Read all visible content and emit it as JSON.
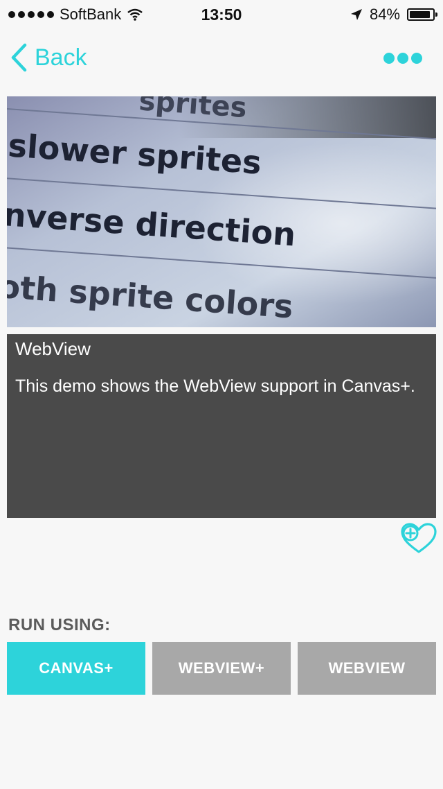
{
  "status_bar": {
    "carrier": "SoftBank",
    "time": "13:50",
    "battery": "84%",
    "battery_level": 0.84,
    "icons": [
      "signal-dots-icon",
      "wifi-icon",
      "location-arrow-icon",
      "battery-icon"
    ]
  },
  "nav": {
    "back_label": "Back",
    "icons": [
      "chevron-left-icon",
      "more-dots-icon"
    ]
  },
  "hero": {
    "lines": [
      "sprites",
      "slower sprites",
      "nverse direction",
      "oth sprite colors"
    ]
  },
  "description": {
    "title": "WebView",
    "body": "This demo shows the WebView support in Canvas+."
  },
  "favorite": {
    "icon": "heart-plus-icon"
  },
  "run": {
    "label": "RUN USING:",
    "options": [
      {
        "label": "CANVAS+",
        "active": true
      },
      {
        "label": "WEBVIEW+",
        "active": false
      },
      {
        "label": "WEBVIEW",
        "active": false
      }
    ]
  },
  "colors": {
    "accent": "#2dd3da",
    "card_bg": "#4a4a4a",
    "inactive_button": "#a8a8a8",
    "page_bg": "#f7f7f7"
  }
}
